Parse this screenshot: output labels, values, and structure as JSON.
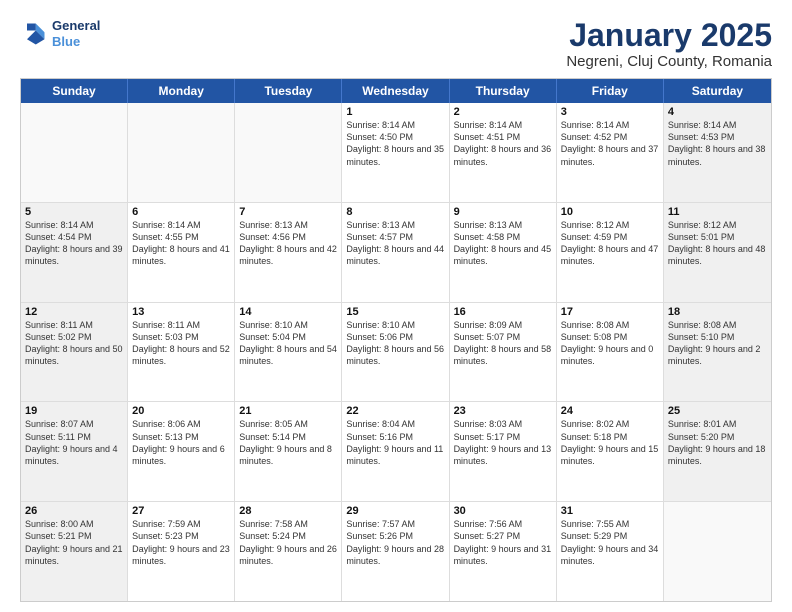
{
  "logo": {
    "line1": "General",
    "line2": "Blue"
  },
  "title": "January 2025",
  "subtitle": "Negreni, Cluj County, Romania",
  "header": {
    "days": [
      "Sunday",
      "Monday",
      "Tuesday",
      "Wednesday",
      "Thursday",
      "Friday",
      "Saturday"
    ]
  },
  "rows": [
    [
      {
        "day": "",
        "empty": true,
        "text": ""
      },
      {
        "day": "",
        "empty": true,
        "text": ""
      },
      {
        "day": "",
        "empty": true,
        "text": ""
      },
      {
        "day": "1",
        "text": "Sunrise: 8:14 AM\nSunset: 4:50 PM\nDaylight: 8 hours and 35 minutes."
      },
      {
        "day": "2",
        "text": "Sunrise: 8:14 AM\nSunset: 4:51 PM\nDaylight: 8 hours and 36 minutes."
      },
      {
        "day": "3",
        "text": "Sunrise: 8:14 AM\nSunset: 4:52 PM\nDaylight: 8 hours and 37 minutes."
      },
      {
        "day": "4",
        "text": "Sunrise: 8:14 AM\nSunset: 4:53 PM\nDaylight: 8 hours and 38 minutes."
      }
    ],
    [
      {
        "day": "5",
        "text": "Sunrise: 8:14 AM\nSunset: 4:54 PM\nDaylight: 8 hours and 39 minutes."
      },
      {
        "day": "6",
        "text": "Sunrise: 8:14 AM\nSunset: 4:55 PM\nDaylight: 8 hours and 41 minutes."
      },
      {
        "day": "7",
        "text": "Sunrise: 8:13 AM\nSunset: 4:56 PM\nDaylight: 8 hours and 42 minutes."
      },
      {
        "day": "8",
        "text": "Sunrise: 8:13 AM\nSunset: 4:57 PM\nDaylight: 8 hours and 44 minutes."
      },
      {
        "day": "9",
        "text": "Sunrise: 8:13 AM\nSunset: 4:58 PM\nDaylight: 8 hours and 45 minutes."
      },
      {
        "day": "10",
        "text": "Sunrise: 8:12 AM\nSunset: 4:59 PM\nDaylight: 8 hours and 47 minutes."
      },
      {
        "day": "11",
        "text": "Sunrise: 8:12 AM\nSunset: 5:01 PM\nDaylight: 8 hours and 48 minutes."
      }
    ],
    [
      {
        "day": "12",
        "text": "Sunrise: 8:11 AM\nSunset: 5:02 PM\nDaylight: 8 hours and 50 minutes."
      },
      {
        "day": "13",
        "text": "Sunrise: 8:11 AM\nSunset: 5:03 PM\nDaylight: 8 hours and 52 minutes."
      },
      {
        "day": "14",
        "text": "Sunrise: 8:10 AM\nSunset: 5:04 PM\nDaylight: 8 hours and 54 minutes."
      },
      {
        "day": "15",
        "text": "Sunrise: 8:10 AM\nSunset: 5:06 PM\nDaylight: 8 hours and 56 minutes."
      },
      {
        "day": "16",
        "text": "Sunrise: 8:09 AM\nSunset: 5:07 PM\nDaylight: 8 hours and 58 minutes."
      },
      {
        "day": "17",
        "text": "Sunrise: 8:08 AM\nSunset: 5:08 PM\nDaylight: 9 hours and 0 minutes."
      },
      {
        "day": "18",
        "text": "Sunrise: 8:08 AM\nSunset: 5:10 PM\nDaylight: 9 hours and 2 minutes."
      }
    ],
    [
      {
        "day": "19",
        "text": "Sunrise: 8:07 AM\nSunset: 5:11 PM\nDaylight: 9 hours and 4 minutes."
      },
      {
        "day": "20",
        "text": "Sunrise: 8:06 AM\nSunset: 5:13 PM\nDaylight: 9 hours and 6 minutes."
      },
      {
        "day": "21",
        "text": "Sunrise: 8:05 AM\nSunset: 5:14 PM\nDaylight: 9 hours and 8 minutes."
      },
      {
        "day": "22",
        "text": "Sunrise: 8:04 AM\nSunset: 5:16 PM\nDaylight: 9 hours and 11 minutes."
      },
      {
        "day": "23",
        "text": "Sunrise: 8:03 AM\nSunset: 5:17 PM\nDaylight: 9 hours and 13 minutes."
      },
      {
        "day": "24",
        "text": "Sunrise: 8:02 AM\nSunset: 5:18 PM\nDaylight: 9 hours and 15 minutes."
      },
      {
        "day": "25",
        "text": "Sunrise: 8:01 AM\nSunset: 5:20 PM\nDaylight: 9 hours and 18 minutes."
      }
    ],
    [
      {
        "day": "26",
        "text": "Sunrise: 8:00 AM\nSunset: 5:21 PM\nDaylight: 9 hours and 21 minutes."
      },
      {
        "day": "27",
        "text": "Sunrise: 7:59 AM\nSunset: 5:23 PM\nDaylight: 9 hours and 23 minutes."
      },
      {
        "day": "28",
        "text": "Sunrise: 7:58 AM\nSunset: 5:24 PM\nDaylight: 9 hours and 26 minutes."
      },
      {
        "day": "29",
        "text": "Sunrise: 7:57 AM\nSunset: 5:26 PM\nDaylight: 9 hours and 28 minutes."
      },
      {
        "day": "30",
        "text": "Sunrise: 7:56 AM\nSunset: 5:27 PM\nDaylight: 9 hours and 31 minutes."
      },
      {
        "day": "31",
        "text": "Sunrise: 7:55 AM\nSunset: 5:29 PM\nDaylight: 9 hours and 34 minutes."
      },
      {
        "day": "",
        "empty": true,
        "text": ""
      }
    ]
  ]
}
